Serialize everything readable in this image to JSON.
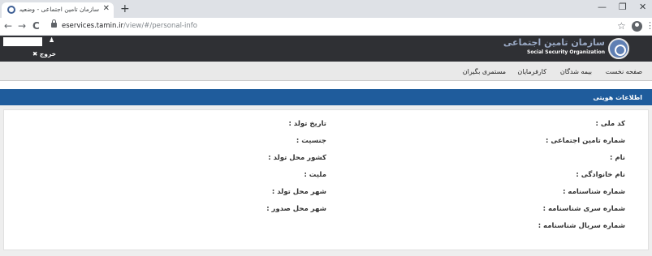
{
  "browser": {
    "tab_title": "سازمان تامین اجتماعی - وضعیت ب",
    "tab_close": "✕",
    "new_tab": "+",
    "back": "←",
    "forward": "→",
    "reload": "C",
    "url_domain": "eservices.tamin.ir",
    "url_path": "/view/#/personal-info",
    "star": "☆",
    "menu": "⋮",
    "minimize": "—",
    "restore": "❐",
    "close": "✕"
  },
  "header": {
    "logout_label": "✖ خروج",
    "user_icon": "♟",
    "logo_fa": "سازمان تامین اجتماعی",
    "logo_en": "Social Security Organization"
  },
  "nav": {
    "items": [
      "صفحه نخست",
      "بیمه شدگان",
      "کارفرمایان",
      "مستمری بگیران"
    ]
  },
  "section": {
    "title": "اطلاعات هویتی"
  },
  "fields": {
    "right": [
      "کد ملی :",
      "شماره تامین اجتماعی :",
      "نام :",
      "نام خانوادگی :",
      "شماره شناسنامه :",
      "شماره سری شناسنامه :",
      "شماره سریال شناسنامه :"
    ],
    "left": [
      "تاریخ تولد :",
      "جنسیت :",
      "کشور محل تولد :",
      "ملیت :",
      "شهر محل تولد :",
      "شهر محل صدور :"
    ]
  },
  "colors": {
    "header_bg": "#2f3034",
    "nav_bg": "#e9e9e9",
    "section_bar": "#1f5c9c",
    "logo_blue": "#5f7fb3"
  }
}
